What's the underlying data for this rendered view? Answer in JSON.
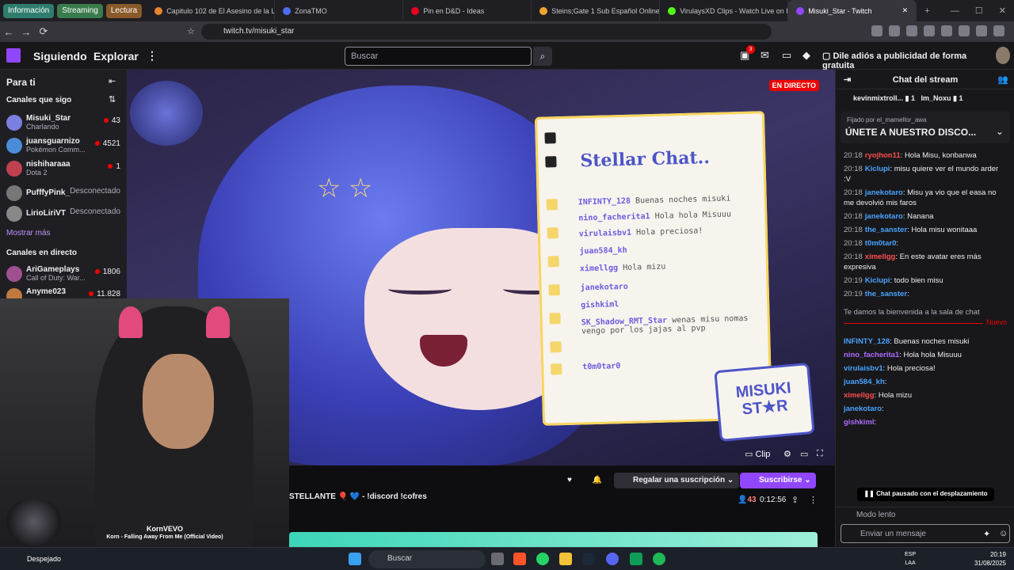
{
  "browser": {
    "tab_groups": [
      {
        "label": "Información",
        "color": "#2f7d6d"
      },
      {
        "label": "Streaming",
        "color": "#3a7b4c"
      },
      {
        "label": "Lectura",
        "color": "#8a5a2a"
      }
    ],
    "tabs": [
      {
        "title": "Capitulo 102 de El Asesino de la Luz",
        "color": "#e8832f"
      },
      {
        "title": "ZonaTMO",
        "color": "#4d6cff"
      },
      {
        "title": "Pin en D&D - Ideas",
        "color": "#e60023"
      },
      {
        "title": "Steins;Gate 1 Sub Español Online gr",
        "color": "#f2a32d"
      },
      {
        "title": "VirulaysXD Clips - Watch Live on Kic",
        "color": "#53fc18"
      },
      {
        "title": "Misuki_Star - Twitch",
        "color": "#9147ff",
        "active": true
      }
    ],
    "url": "twitch.tv/misuki_star"
  },
  "twitch": {
    "nav": {
      "following": "Siguiendo",
      "browse": "Explorar",
      "more": "⋮"
    },
    "search_placeholder": "Buscar",
    "notif_count": "3",
    "ad_cta": "Dile adiós a publicidad de forma gratuita"
  },
  "sidebar": {
    "title": "Para ti",
    "followed_header": "Canales que sigo",
    "channels": [
      {
        "name": "Misuki_Star",
        "game": "Charlando",
        "viewers": "43",
        "color": "#7b7fe0"
      },
      {
        "name": "juansguarnizo",
        "game": "Pokémon Comm...",
        "viewers": "4521",
        "color": "#4a8cd8"
      },
      {
        "name": "nishiharaaa",
        "game": "Dota 2",
        "viewers": "1",
        "color": "#c04050"
      },
      {
        "name": "PufffyPink_",
        "status": "Desconectado",
        "color": "#777"
      },
      {
        "name": "LirioLiriVT",
        "status": "Desconectado",
        "color": "#888"
      }
    ],
    "show_more": "Mostrar más",
    "live_header": "Canales en directo",
    "live_channels": [
      {
        "name": "AriGameplays",
        "game": "Call of Duty: War...",
        "viewers": "1806",
        "color": "#a05090"
      },
      {
        "name": "Anyme023",
        "game": "",
        "viewers": "11.828",
        "color": "#c07a40"
      }
    ]
  },
  "video": {
    "live_badge": "EN DIRECTO",
    "board_title": "Stellar Chat..",
    "board_lines": [
      {
        "user": "INFINTY_128",
        "text": "Buenas noches misuki"
      },
      {
        "user": "nino_facherita1",
        "text": "Hola hola Misuuu"
      },
      {
        "user": "virulaisbv1",
        "text": "Hola preciosa!"
      },
      {
        "user": "juan584_kh",
        "text": ""
      },
      {
        "user": "ximellgg",
        "text": "Hola mizu"
      },
      {
        "user": "janekotaro",
        "text": ""
      },
      {
        "user": "gishkiml",
        "text": ""
      },
      {
        "user": "SK_Shadow_RMT_Star",
        "text": "wenas misu nomas vengo por los jajas al pvp"
      },
      {
        "user": "t0m0tar0",
        "text": ""
      }
    ],
    "logo_line1": "MISUKI",
    "logo_line2": "ST★R",
    "clip_label": "Clip"
  },
  "webcam": {
    "media_title": "KornVEVO",
    "media_subtitle": "Korn - Falling Away From Me (Official Video)",
    "weather": "Despejado"
  },
  "stream_info": {
    "title": "STELLANTE 🎈 💙 - !discord !cofres",
    "gift_label": "Regalar una suscripción",
    "sub_label": "Suscribirse",
    "viewers": "43",
    "uptime": "0:12:56"
  },
  "chat": {
    "header": "Chat del stream",
    "top_gifters": [
      {
        "name": "kevinmixtroll...",
        "count": "1"
      },
      {
        "name": "Im_Noxu",
        "count": "1"
      }
    ],
    "pinned_by": "Fijado por el_mamellor_awa",
    "pinned_text": "ÚNETE A NUESTRO DISCO...",
    "messages_before": [
      {
        "time": "20:18",
        "user": "ryojhon11",
        "text": "Hola Misu, konbanwa",
        "color": "#ff4f4f"
      },
      {
        "time": "20:18",
        "user": "Kiclupi",
        "text": "misu quiere ver el mundo arder :V",
        "color": "#4aa3ff"
      },
      {
        "time": "20:18",
        "user": "janekotaro",
        "text": "Misu ya vio que el easa no me devolvió mis faros",
        "color": "#4aa3ff"
      },
      {
        "time": "20:18",
        "user": "janekotaro",
        "text": "Nanana",
        "color": "#4aa3ff"
      },
      {
        "time": "20:18",
        "user": "the_sanster",
        "text": "Hola misu wonitaaa",
        "color": "#4aa3ff"
      },
      {
        "time": "20:18",
        "user": "t0m0tar0",
        "text": "",
        "color": "#4aa3ff"
      },
      {
        "time": "20:18",
        "user": "ximellgg",
        "text": "En este avatar eres más expresiva",
        "color": "#ff4f4f"
      },
      {
        "time": "20:19",
        "user": "Kiclupi",
        "text": "todo bien misu",
        "color": "#4aa3ff"
      },
      {
        "time": "20:19",
        "user": "the_sanster",
        "text": "",
        "color": "#4aa3ff"
      }
    ],
    "welcome": "Te damos la bienvenida a la sala de chat",
    "new_label": "Nuevo",
    "messages_after": [
      {
        "user": "INFINTY_128",
        "text": "Buenas noches misuki",
        "color": "#4aa3ff"
      },
      {
        "user": "nino_facherita1",
        "text": "Hola hola Misuuu",
        "color": "#b06cff"
      },
      {
        "user": "virulaisbv1",
        "text": "Hola preciosa!",
        "color": "#4aa3ff"
      },
      {
        "user": "juan584_kh",
        "text": "",
        "color": "#4aa3ff"
      },
      {
        "user": "ximellgg",
        "text": "Hola mizu",
        "color": "#ff4f4f"
      },
      {
        "user": "janekotaro",
        "text": "",
        "color": "#4aa3ff"
      },
      {
        "user": "gishkiml",
        "text": "",
        "color": "#b06cff"
      }
    ],
    "paused": "Chat pausado con el desplazamiento",
    "slow_mode": "Modo lento",
    "input_placeholder": "Enviar un mensaje"
  },
  "taskbar": {
    "search": "Buscar",
    "lang": "ESP",
    "lang2": "LAA",
    "time": "20:19",
    "date": "31/08/2025"
  },
  "icons": {
    "search": "search-icon",
    "heart": "heart-icon",
    "bell": "bell-icon",
    "star": "star-icon"
  }
}
